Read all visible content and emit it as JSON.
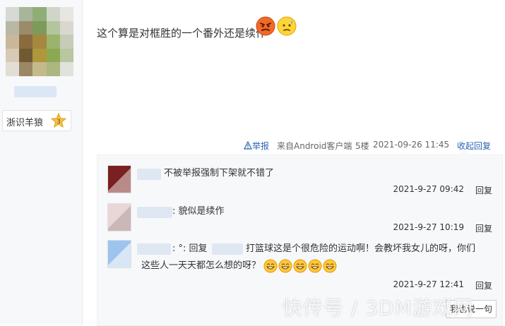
{
  "author": {
    "level_name": "浙识羊狼",
    "level_number": "3"
  },
  "post": {
    "content": "这个算是对框胜的一个番外还是续作",
    "emojis": [
      "anger-face-emoji",
      "sweat-face-emoji"
    ]
  },
  "meta": {
    "report_label": "举报",
    "source": "来自Android客户端",
    "floor": "5楼",
    "time": "2021-09-26 11:45",
    "collapse_label": "收起回复"
  },
  "replies": [
    {
      "text": "不被举报强制下架就不错了",
      "time": "2021-9-27 09:42",
      "reply_label": "回复"
    },
    {
      "text": ": 貌似是续作",
      "time": "2021-9-27 10:19",
      "reply_label": "回复"
    },
    {
      "prefix": ": °: 回复",
      "text_line1": "打篮球这是个很危险的运动啊！会教坏我女儿的呀，你们",
      "text_line2": "这些人一天天都怎么想的呀？",
      "time": "2021-9-27 12:41",
      "reply_label": "回复"
    }
  ],
  "reply_button_label": "我也说一句",
  "watermark": "快传号 / 3DM游戏网",
  "colors": {
    "link": "#2d64b3",
    "reply_bg": "#f7f8fa",
    "sidebar_bg": "#f7f8fa"
  }
}
